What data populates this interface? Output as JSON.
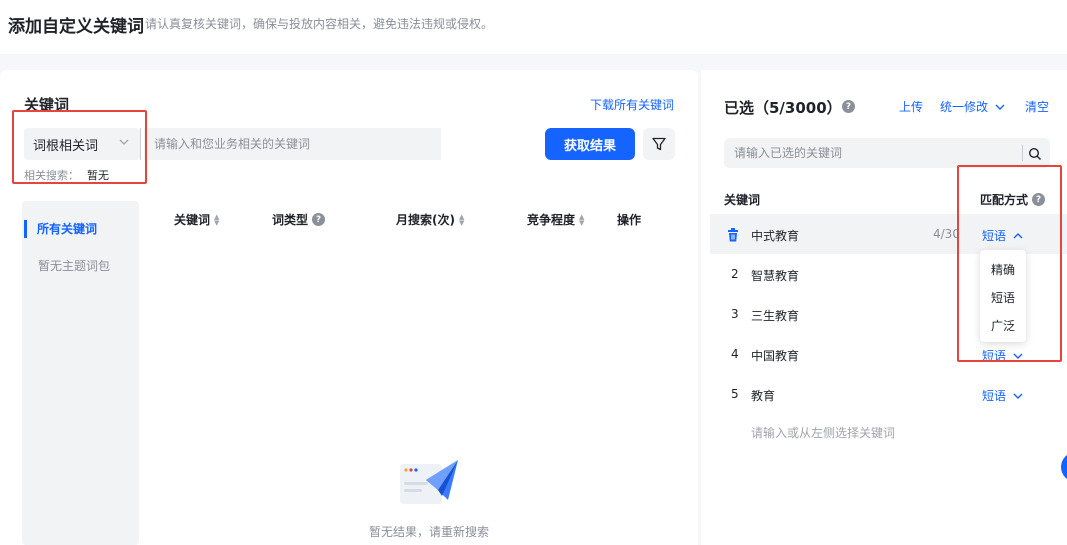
{
  "header": {
    "title": "添加自定义关键词",
    "subtitle": "请认真复核关键词，确保与投放内容相关，避免违法违规或侵权。"
  },
  "left": {
    "title": "关键词",
    "download_link": "下载所有关键词",
    "select_value": "词根相关词",
    "search_placeholder": "请输入和您业务相关的关键词",
    "submit_label": "获取结果",
    "related_label": "相关搜索：",
    "related_value": "暂无",
    "sidebar": {
      "active_item": "所有关键词",
      "item2": "暂无主题词包"
    },
    "columns": {
      "keyword": "关键词",
      "type": "词类型",
      "monthly": "月搜索(次)",
      "competition": "竞争程度",
      "action": "操作"
    },
    "empty_text": "暂无结果，请重新搜索"
  },
  "right": {
    "title": "已选（5/3000）",
    "upload": "上传",
    "bulk_edit": "统一修改",
    "clear": "清空",
    "search_placeholder": "请输入已选的关键词",
    "col_keyword": "关键词",
    "col_match": "匹配方式",
    "rows": [
      {
        "index": "1",
        "keyword": "中式教育",
        "count": "4/30",
        "match": "短语"
      },
      {
        "index": "2",
        "keyword": "智慧教育",
        "count": "",
        "match": ""
      },
      {
        "index": "3",
        "keyword": "三生教育",
        "count": "",
        "match": ""
      },
      {
        "index": "4",
        "keyword": "中国教育",
        "count": "",
        "match": "短语"
      },
      {
        "index": "5",
        "keyword": "教育",
        "count": "",
        "match": "短语"
      }
    ],
    "dropdown_options": [
      "精确",
      "短语",
      "广泛"
    ],
    "add_placeholder": "请输入或从左侧选择关键词"
  },
  "colors": {
    "accent": "#1664ff",
    "highlight_box": "#e5453b"
  }
}
